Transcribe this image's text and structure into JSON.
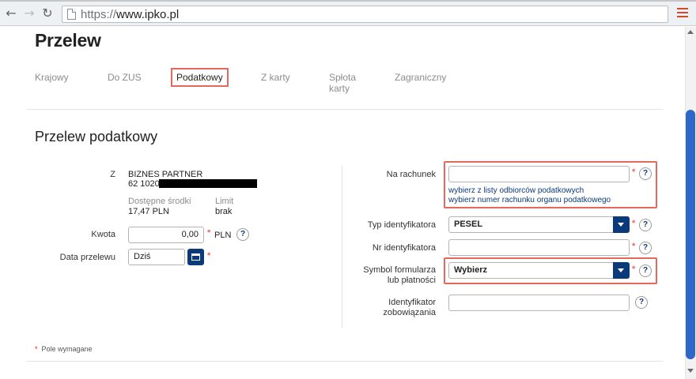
{
  "browser": {
    "url_scheme": "https://",
    "url_host": "www.ipko.pl"
  },
  "page": {
    "title": "Przelew",
    "tabs": [
      {
        "label": "Krajowy"
      },
      {
        "label": "Do ZUS"
      },
      {
        "label": "Podatkowy",
        "active": true
      },
      {
        "label": "Z karty"
      },
      {
        "label": "Spłota\nkarty"
      },
      {
        "label": "Zagraniczny"
      }
    ],
    "section_title": "Przelew podatkowy"
  },
  "from": {
    "label": "Z",
    "account_name": "BIZNES PARTNER",
    "account_number_prefix": "62 1020",
    "available_label": "Dostępne środki",
    "available_value": "17,47 PLN",
    "limit_label": "Limit",
    "limit_value": "brak"
  },
  "amount": {
    "label": "Kwota",
    "value": "0,00",
    "currency": "PLN"
  },
  "date": {
    "label": "Data przelewu",
    "value": "Dziś"
  },
  "right_form": {
    "account_label": "Na rachunek",
    "account_value": "",
    "link_choose_recipient": "wybierz z listy odbiorców podatkowych",
    "link_choose_account": "wybierz numer rachunku organu podatkowego",
    "id_type_label": "Typ identyfikatora",
    "id_type_value": "PESEL",
    "id_number_label": "Nr identyfikatora",
    "id_number_value": "",
    "form_symbol_label": "Symbol formularza\nlub płatności",
    "form_symbol_value": "Wybierz",
    "liability_label": "Identyfikator\nzobowiązania",
    "liability_value": ""
  },
  "footer": {
    "required_note": "Pole wymagane"
  },
  "ui": {
    "required_marker": "*",
    "help_marker": "?"
  },
  "colors": {
    "highlight": "#e4685e",
    "primary_blue": "#0b3a7a",
    "scroll_thumb": "#2f67c9"
  },
  "icons": [
    "back-arrow-icon",
    "forward-arrow-icon",
    "reload-icon",
    "page-icon",
    "menu-icon",
    "calendar-icon",
    "dropdown-arrow-icon",
    "help-icon"
  ]
}
